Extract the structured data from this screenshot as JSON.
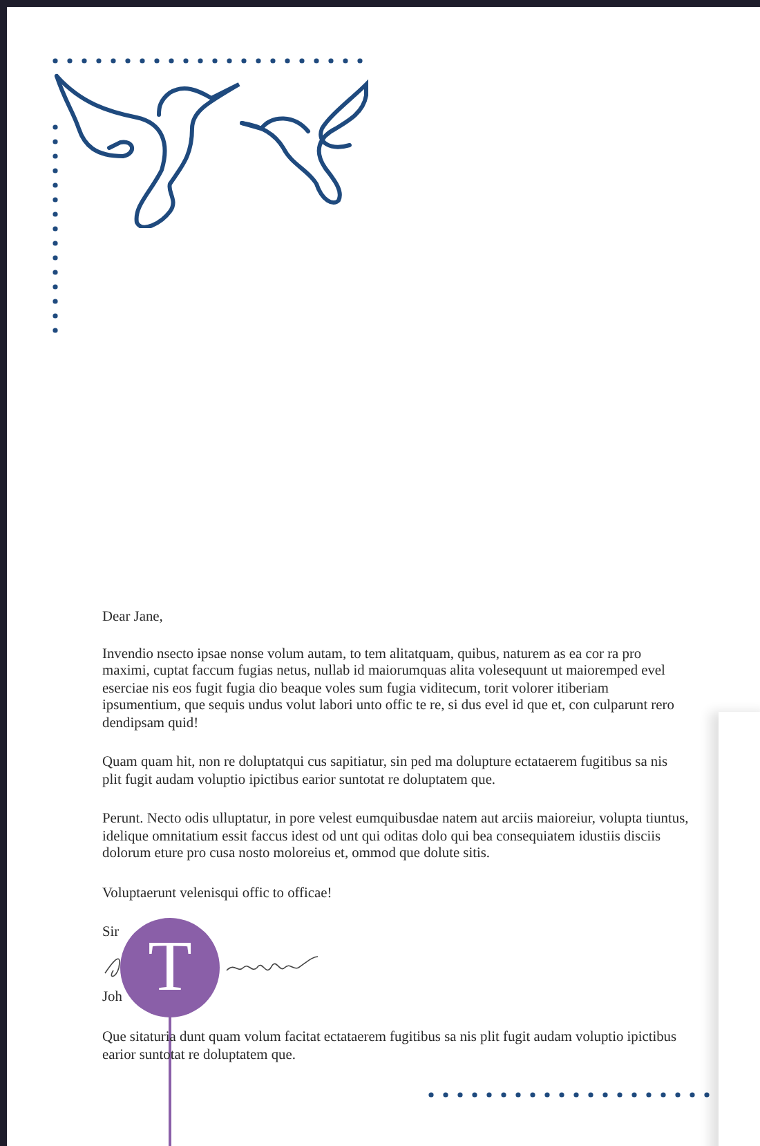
{
  "letter": {
    "greeting": "Dear Jane,",
    "paragraphs": [
      "Invendio nsecto ipsae nonse volum autam, to tem alitatquam, quibus, naturem as ea cor ra pro maximi, cuptat faccum fugias netus, nullab id maiorumquas alita volesequunt ut maioremped evel eserciae nis eos fugit fugia dio beaque voles sum fugia viditecum, torit volorer itiberiam ipsumentium, que sequis undus volut labori unto offic te re, si dus evel id que et, con culparunt rero dendipsam quid!",
      "Quam quam hit, non re doluptatqui cus sapitiatur, sin ped ma dolupture ectataerem fugitibus sa nis plit fugit audam voluptio ipictibus earior suntotat re doluptatem que.",
      "Perunt. Necto odis ulluptatur, in pore velest eumquibusdae natem aut arciis maioreiur, volupta tiuntus, idelique omnitatium essit faccus idest od unt qui oditas dolo qui bea consequiatem idustiis disciis dolorum eture pro cusa nosto moloreius et, ommod que dolute sitis.",
      "Voluptaerunt velenisqui offic to officae!"
    ],
    "signoff": "Sir",
    "name": "Joh",
    "postscript": "Que sitaturia dunt quam volum facitat ectataerem fugitibus sa nis plit fugit audam voluptio ipictibus earior suntotat re doluptatem que."
  },
  "text_tool_marker": {
    "glyph": "T"
  }
}
